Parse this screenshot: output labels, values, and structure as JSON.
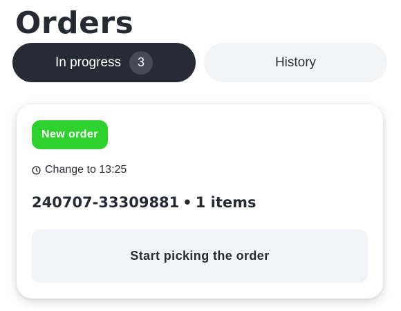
{
  "page": {
    "title": "Orders"
  },
  "tabs": [
    {
      "label": "In progress",
      "count": "3",
      "active": true
    },
    {
      "label": "History",
      "active": false
    }
  ],
  "order_card": {
    "status": "New order",
    "status_color": "#2fd12f",
    "time_icon": "clock-icon",
    "time_text": "Change to 13:25",
    "order_number": "240707-33309881",
    "separator": "•",
    "items_text": "1 items",
    "action_label": "Start picking the order"
  },
  "colors": {
    "active_tab": "#272b36",
    "inactive_tab": "#f3f4f6",
    "action_button": "#f1f3f6"
  }
}
